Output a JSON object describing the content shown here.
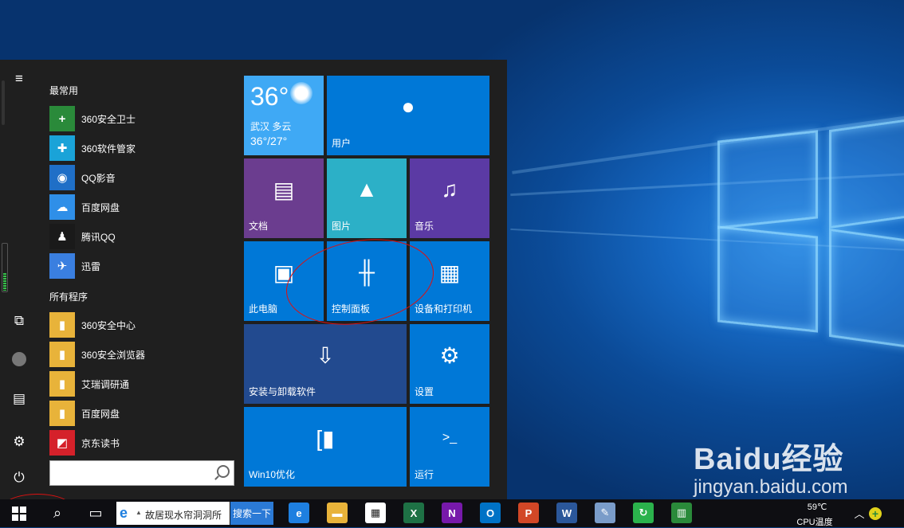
{
  "start_menu": {
    "most_used_header": "最常用",
    "most_used": [
      {
        "label": "360安全卫士",
        "icon": "360-safeguard-icon",
        "color": "#2a8a3a",
        "glyph": "+"
      },
      {
        "label": "360软件管家",
        "icon": "360-software-manager-icon",
        "color": "#1aa3d8",
        "glyph": "✚"
      },
      {
        "label": "QQ影音",
        "icon": "qq-player-icon",
        "color": "#1f6fc7",
        "glyph": "◉"
      },
      {
        "label": "百度网盘",
        "icon": "baidu-netdisk-icon",
        "color": "#2f8fe8",
        "glyph": "☁"
      },
      {
        "label": "腾讯QQ",
        "icon": "qq-penguin-icon",
        "color": "#1a1a1a",
        "glyph": "♟"
      },
      {
        "label": "迅雷",
        "icon": "xunlei-icon",
        "color": "#3a7fe0",
        "glyph": "✈"
      }
    ],
    "all_programs_header": "所有程序",
    "all_programs": [
      {
        "label": "360安全中心",
        "icon": "folder-icon",
        "color": "#e8b33a",
        "glyph": "▮"
      },
      {
        "label": "360安全浏览器",
        "icon": "folder-icon",
        "color": "#e8b33a",
        "glyph": "▮"
      },
      {
        "label": "艾瑞调研通",
        "icon": "folder-icon",
        "color": "#e8b33a",
        "glyph": "▮"
      },
      {
        "label": "百度网盘",
        "icon": "folder-icon",
        "color": "#e8b33a",
        "glyph": "▮"
      },
      {
        "label": "京东读书",
        "icon": "jd-read-icon",
        "color": "#d5212a",
        "glyph": "◩"
      }
    ],
    "search_placeholder": ""
  },
  "tiles": {
    "weather": {
      "temp": "36°",
      "city": "武汉  多云",
      "range": "36°/27°"
    },
    "users": {
      "label": "用户",
      "icon": "user-icon",
      "glyph": "●"
    },
    "documents": {
      "label": "文档",
      "icon": "document-icon",
      "glyph": "▤"
    },
    "pictures": {
      "label": "图片",
      "icon": "picture-icon",
      "glyph": "▲"
    },
    "music": {
      "label": "音乐",
      "icon": "headphones-icon",
      "glyph": "♫"
    },
    "this_pc": {
      "label": "此电脑",
      "icon": "monitor-icon",
      "glyph": "▣"
    },
    "control_panel": {
      "label": "控制面板",
      "icon": "sliders-icon",
      "glyph": "╫"
    },
    "devices_printers": {
      "label": "设备和打印机",
      "icon": "printer-icon",
      "glyph": "▦"
    },
    "install_uninstall": {
      "label": "安装与卸载软件",
      "icon": "install-box-icon",
      "glyph": "⇩"
    },
    "settings": {
      "label": "设置",
      "icon": "gear-icon",
      "glyph": "⚙"
    },
    "win10_optimize": {
      "label": "Win10优化",
      "icon": "optimize-icon",
      "glyph": "[▮"
    },
    "run": {
      "label": "运行",
      "icon": "run-icon",
      "glyph": ">_"
    }
  },
  "taskbar": {
    "ie_text": "故居现水帘洞洞所",
    "search_button": "搜索一下",
    "temperature": "59℃",
    "temperature_label": "CPU温度",
    "apps": [
      {
        "name": "edge-icon",
        "glyph": "e",
        "color": "#1e7fe0"
      },
      {
        "name": "file-explorer-icon",
        "glyph": "▬",
        "color": "#e8b33a"
      },
      {
        "name": "store-icon",
        "glyph": "▦",
        "color": "#ffffff"
      },
      {
        "name": "excel-icon",
        "glyph": "X",
        "color": "#1e7145"
      },
      {
        "name": "onenote-icon",
        "glyph": "N",
        "color": "#7719aa"
      },
      {
        "name": "outlook-icon",
        "glyph": "O",
        "color": "#0072c6"
      },
      {
        "name": "powerpoint-icon",
        "glyph": "P",
        "color": "#d24726"
      },
      {
        "name": "word-icon",
        "glyph": "W",
        "color": "#2b579a"
      },
      {
        "name": "paint-icon",
        "glyph": "✎",
        "color": "#7a9cc9"
      },
      {
        "name": "refresh-app-icon",
        "glyph": "↻",
        "color": "#2bb24c"
      },
      {
        "name": "chart-app-icon",
        "glyph": "▥",
        "color": "#2a8a3a"
      }
    ]
  },
  "watermark": {
    "logo": "Baidu经验",
    "url": "jingyan.baidu.com"
  },
  "colors": {
    "tile_blue": "#0078d7",
    "tile_purple": "#6b3d8f",
    "tile_teal": "#2cb0c7",
    "tile_violet": "#5b3aa4",
    "tile_navy": "#224a8f",
    "weather": "#3fa9f5"
  }
}
